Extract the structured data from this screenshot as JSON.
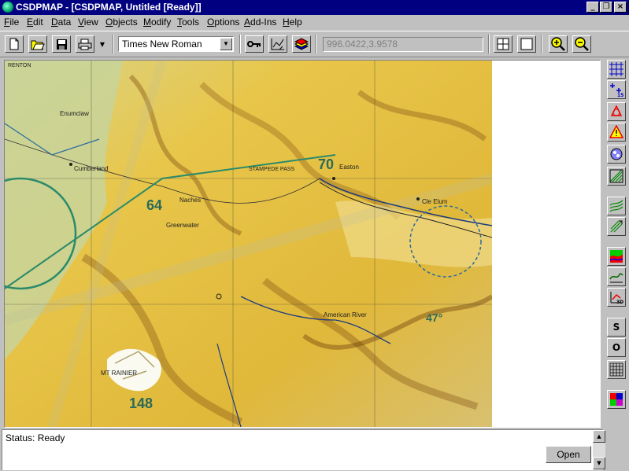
{
  "window": {
    "title": "CSDPMAP - [CSDPMAP, Untitled [Ready]]",
    "minimize_glyph": "_",
    "restore_glyph": "❐",
    "close_glyph": "×"
  },
  "menu": [
    {
      "u": "F",
      "rest": "ile"
    },
    {
      "u": "E",
      "rest": "dit"
    },
    {
      "u": "D",
      "rest": "ata"
    },
    {
      "u": "V",
      "rest": "iew"
    },
    {
      "u": "O",
      "rest": "bjects"
    },
    {
      "u": "M",
      "rest": "odify"
    },
    {
      "u": "T",
      "rest": "ools"
    },
    {
      "u": "O",
      "rest": "ptions"
    },
    {
      "u": "A",
      "rest": "dd-Ins"
    },
    {
      "u": "H",
      "rest": "elp"
    }
  ],
  "toolbar": {
    "font_value": "Times New Roman",
    "coordinates": "996.0422,3.9578"
  },
  "map": {
    "labels": {
      "l64": "64",
      "l70": "70",
      "l148": "148",
      "l47": "47°",
      "cumberland": "Cumberland",
      "greenwater": "Greenwater",
      "american_river": "American River",
      "mt_rainier": "MT RAINIER",
      "cle_elum": "Cle Elum",
      "naches": "Naches",
      "easton": "Easton",
      "stampede": "STAMPEDE PASS",
      "enumclaw": "Enumclaw",
      "renton": "RENTON"
    }
  },
  "status": {
    "text": "Status: Ready",
    "open_label": "Open"
  },
  "colors": {
    "titlebar": "#000080",
    "face": "#c0c0c0",
    "map_base": "#e6c547"
  }
}
